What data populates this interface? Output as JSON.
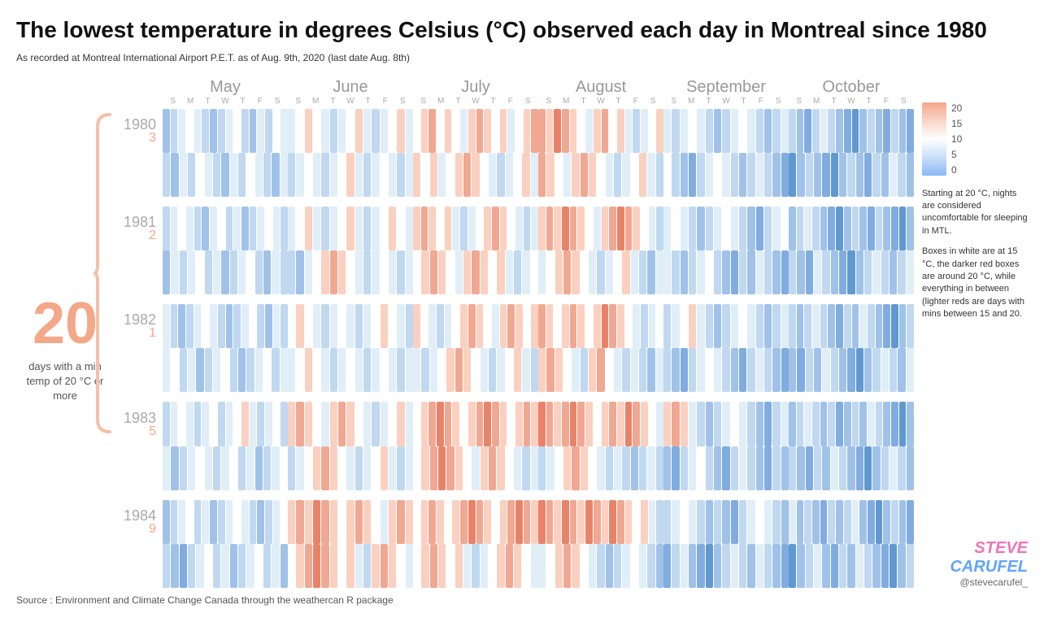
{
  "title": "The lowest temperature in degrees Celsius (°C) observed each day in Montreal since 1980",
  "subtitle": "As recorded at Montreal International Airport P.E.T. as of Aug. 9th, 2020",
  "subtitle_note": "(last date Aug. 8th)",
  "months": [
    "May",
    "June",
    "July",
    "August",
    "September",
    "October"
  ],
  "day_letters": [
    "S",
    "M",
    "T",
    "W",
    "T",
    "F",
    "S"
  ],
  "years": [
    {
      "year": "1980",
      "count": "3"
    },
    {
      "year": "1981",
      "count": "2"
    },
    {
      "year": "1982",
      "count": "1"
    },
    {
      "year": "1983",
      "count": "5"
    },
    {
      "year": "1984",
      "count": "9"
    }
  ],
  "big_number": "20",
  "days_label": "days with a min temp of 20 °C or more",
  "legend_values": [
    "20",
    "15",
    "10",
    "5",
    "0"
  ],
  "annotation1": "Starting at 20 °C, nights are considered uncomfortable for sleeping in MTL.",
  "annotation2": "Boxes in white are at 15 °C, the darker red boxes are around 20 °C, while everything in between (lighter reds are days with mins between 15 and 20.",
  "logo_line1": "STEVE",
  "logo_line2": "CARUFEL",
  "twitter": "@stevecarufel_",
  "source": "Source : Environment and Climate Change Canada through the weathercan R package"
}
